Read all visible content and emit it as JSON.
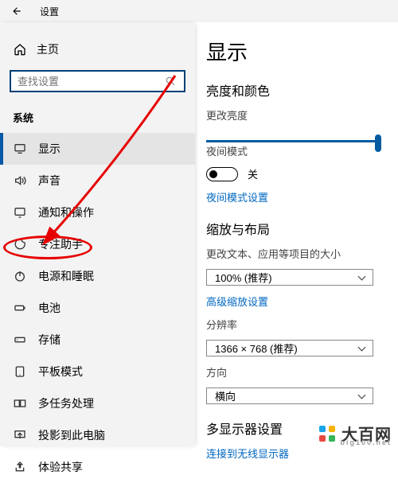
{
  "topbar": {
    "title": "设置"
  },
  "sidebar": {
    "home": "主页",
    "search_placeholder": "查找设置",
    "section_label": "系统",
    "items": [
      {
        "icon": "display",
        "label": "显示",
        "active": true
      },
      {
        "icon": "sound",
        "label": "声音"
      },
      {
        "icon": "notify",
        "label": "通知和操作"
      },
      {
        "icon": "focus",
        "label": "专注助手"
      },
      {
        "icon": "power",
        "label": "电源和睡眠"
      },
      {
        "icon": "battery",
        "label": "电池"
      },
      {
        "icon": "storage",
        "label": "存储"
      },
      {
        "icon": "tablet",
        "label": "平板模式"
      },
      {
        "icon": "multitask",
        "label": "多任务处理"
      },
      {
        "icon": "project",
        "label": "投影到此电脑"
      },
      {
        "icon": "share",
        "label": "体验共享"
      }
    ]
  },
  "content": {
    "page_title": "显示",
    "section_brightness": "亮度和颜色",
    "brightness_label": "更改亮度",
    "night_mode_label": "夜间模式",
    "toggle_off_text": "关",
    "night_mode_link": "夜间模式设置",
    "section_scale": "缩放与布局",
    "scale_label": "更改文本、应用等项目的大小",
    "scale_value": "100% (推荐)",
    "advanced_scale_link": "高级缩放设置",
    "resolution_label": "分辨率",
    "resolution_value": "1366 × 768 (推荐)",
    "orientation_label": "方向",
    "orientation_value": "横向",
    "section_multi": "多显示器设置",
    "connect_wireless_link": "连接到无线显示器"
  },
  "watermark": {
    "brand": "大百网",
    "sub": "big100.net"
  }
}
